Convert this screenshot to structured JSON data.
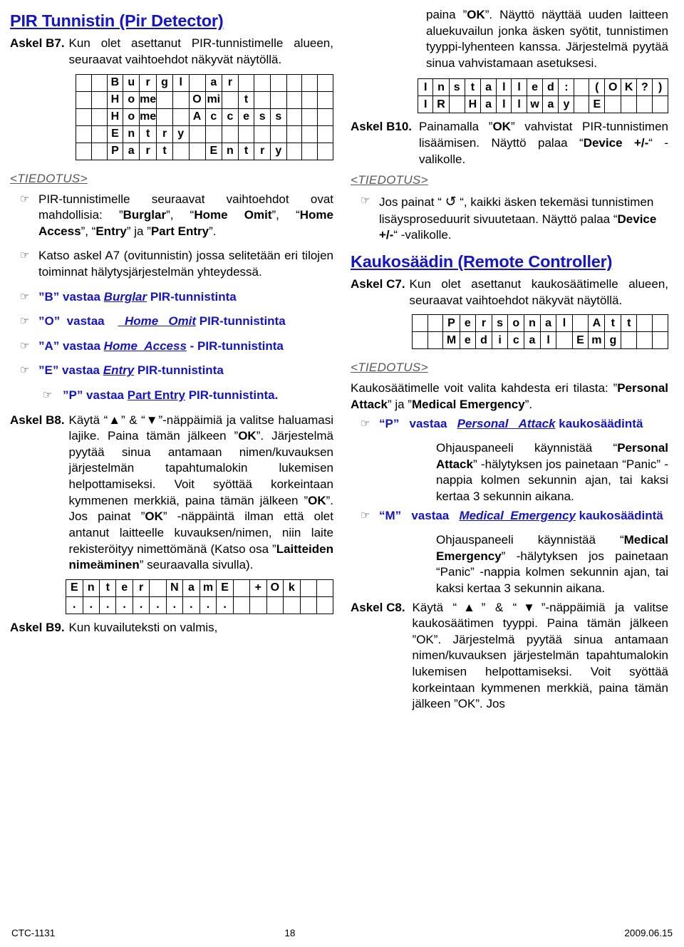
{
  "document": {
    "footer": {
      "left": "CTC-1131",
      "page": "18",
      "date": "2009.06.15"
    },
    "colors": {
      "heading_blue": "#1414c8",
      "note_gray": "#585858",
      "text": "#000000"
    }
  },
  "left_column": {
    "title": "PIR Tunnistin (Pir Detector)",
    "step_b7": {
      "label": "Askel B7.",
      "text": "Kun olet asettanut PIR-tunnistimelle alueen, seuraavat vaihtoehdot näkyvät näytöllä."
    },
    "lcd_b7": {
      "name": "pir-options-lcd",
      "columns": 16,
      "rows": [
        [
          "",
          "",
          "B",
          "u",
          "r",
          "g",
          "l",
          "",
          "a",
          "r",
          "",
          "",
          "",
          "",
          "",
          ""
        ],
        [
          "",
          "",
          "H",
          "o",
          "me",
          "",
          "",
          "O",
          "mi",
          "",
          "t",
          "",
          "",
          "",
          "",
          ""
        ],
        [
          "",
          "",
          "H",
          "o",
          "me",
          "",
          "",
          "A",
          "c",
          "c",
          "e",
          "s",
          "s",
          "",
          "",
          ""
        ],
        [
          "",
          "",
          "E",
          "n",
          "t",
          "r",
          "y",
          "",
          "",
          "",
          "",
          "",
          "",
          "",
          "",
          ""
        ],
        [
          "",
          "",
          "P",
          "a",
          "r",
          "t",
          "",
          "",
          "E",
          "n",
          "t",
          "r",
          "y",
          "",
          "",
          ""
        ]
      ]
    },
    "tiedotus_1": "<TIEDOTUS>",
    "note_1": {
      "icon": "pointing-hand-icon",
      "text": "PIR-tunnistimelle seuraavat vaihtoehdot ovat mahdollisia: ”Burglar”, “Home Omit”, “Home Access”, “Entry” ja ”Part Entry”.",
      "bold_terms": [
        "Burglar",
        "Home Omit",
        "Home Access",
        "Entry",
        "Part Entry"
      ]
    },
    "note_2": {
      "icon": "pointing-hand-icon",
      "text": "Katso askel A7 (ovitunnistin) jossa selitetään eri tilojen toiminnat hälytysjärjestelmän yhteydessä."
    },
    "mappings": [
      {
        "key": "”B”",
        "verb": "vastaa",
        "mode": "Burglar",
        "suffix": "PIR-tunnistinta"
      },
      {
        "key": "”O”",
        "verb": "vastaa",
        "mode": "Home Omit",
        "suffix": "PIR-tunnistinta"
      },
      {
        "key": "”A”",
        "verb": "vastaa",
        "mode": "Home Access",
        "suffix": "- PIR-tunnistinta"
      },
      {
        "key": "”E”",
        "verb": "vastaa",
        "mode": "Entry",
        "suffix": "PIR-tunnistinta"
      },
      {
        "key": "”P”",
        "verb": "vastaa",
        "mode": "Part Entry",
        "suffix": "PIR-tunnistinta."
      }
    ],
    "step_b8": {
      "label": "Askel B8.",
      "text_part1": "Käytä “",
      "up_arrow": "▲",
      "text_part2": "” & “",
      "down_arrow": "▼",
      "text_part3": "”-näppäimiä ja valitse haluamasi lajike. Paina tämän jälkeen ”OK”. Järjestelmä pyytää sinua antamaan nimen/kuvauksen järjestelmän tapahtumalokin lukemisen helpottamiseksi. Voit syöttää korkeintaan kymmenen merkkiä, paina tämän jälkeen ”OK”. Jos painat ”OK” -näppäintä ilman että olet antanut laitteelle kuvauksen/nimen, niin laite rekisteröityy nimettömänä (Katso osa ”Laitteiden nimeäminen” seuraavalla sivulla)."
    },
    "lcd_b8": {
      "name": "enter-name-lcd",
      "columns": 16,
      "rows": [
        [
          "E",
          "n",
          "t",
          "e",
          "r",
          "",
          "N",
          "a",
          "m",
          "E",
          "",
          "+",
          "O",
          "k",
          "",
          ""
        ],
        [
          ".",
          ".",
          ".",
          ".",
          ".",
          ".",
          ".",
          ".",
          ".",
          ".",
          "",
          "",
          "",
          "",
          "",
          ""
        ]
      ]
    },
    "step_b9": {
      "label": "Askel B9.",
      "text": "Kun kuvailuteksti on valmis,"
    }
  },
  "right_column": {
    "b9_continued": "paina ”OK”. Näyttö näyttää uuden laitteen aluekuvailun jonka äsken syötit, tunnistimen tyyppi-lyhenteen kanssa. Järjestelmä pyytää sinua vahvistamaan asetuksesi.",
    "lcd_installed": {
      "name": "installed-confirm-lcd",
      "columns": 16,
      "rows": [
        [
          "I",
          "n",
          "s",
          "t",
          "a",
          "l",
          "l",
          "e",
          "d",
          ":",
          "",
          "(",
          "O",
          "K",
          "?",
          ")"
        ],
        [
          "I",
          "R",
          "",
          "H",
          "a",
          "l",
          "l",
          "w",
          "a",
          "y",
          "",
          "E",
          "",
          "",
          "",
          ""
        ]
      ]
    },
    "step_b10": {
      "label": "Askel B10.",
      "text": "Painamalla ”OK” vahvistat PIR-tunnistimen lisäämisen. Näyttö palaa “Device +/-“ -valikolle."
    },
    "tiedotus_2": "<TIEDOTUS>",
    "note_3": {
      "icon": "pointing-hand-icon",
      "prefix": "Jos painat “",
      "symbol": "↺",
      "symbol_name": "return-arrow-icon",
      "suffix": "“, kaikki äsken tekemäsi tunnistimen lisäysproseduurit sivuutetaan. Näyttö palaa “Device +/-“ -valikolle."
    },
    "title": "Kaukosäädin (Remote Controller)",
    "step_c7": {
      "label": "Askel C7.",
      "text": "Kun olet asettanut kaukosäätimelle alueen, seuraavat vaihtoehdot näkyvät näytöllä."
    },
    "lcd_c7": {
      "name": "remote-options-lcd",
      "columns": 16,
      "rows": [
        [
          "",
          "",
          "P",
          "e",
          "r",
          "s",
          "o",
          "n",
          "a",
          "l",
          "",
          "A",
          "t",
          "t",
          "",
          ""
        ],
        [
          "",
          "",
          "M",
          "e",
          "d",
          "i",
          "c",
          "a",
          "l",
          "",
          "E",
          "m",
          "g",
          "",
          "",
          ""
        ]
      ]
    },
    "tiedotus_3": "<TIEDOTUS>",
    "remote_intro": "Kaukosäätimelle voit valita kahdesta eri tilasta: ”Personal Attack” ja ”Medical Emergency”.",
    "mapping_p": {
      "key": "“P”",
      "verb": "vastaa",
      "mode": "Personal Attack",
      "suffix": "kaukosäädintä"
    },
    "desc_p": "Ohjauspaneeli käynnistää “Personal Attack” -hälytyksen jos painetaan “Panic” -nappia kolmen sekunnin ajan, tai kaksi kertaa 3 sekunnin aikana.",
    "mapping_m": {
      "key": "“M”",
      "verb": "vastaa",
      "mode": "Medical Emergency",
      "suffix": "kaukosäädintä"
    },
    "desc_m": "Ohjauspaneeli käynnistää “Medical Emergency” -hälytyksen jos painetaan “Panic” -nappia kolmen sekunnin ajan, tai kaksi kertaa 3 sekunnin aikana.",
    "step_c8": {
      "label": "Askel C8.",
      "text_part1": "Käytä “",
      "up_arrow": "▲",
      "text_part2": "” & “",
      "down_arrow": "▼",
      "text_part3": "”-näppäimiä ja valitse kaukosäätimen tyyppi. Paina tämän jälkeen ”OK”. Järjestelmä pyytää sinua antamaan nimen/kuvauksen järjestelmän tapahtumalokin lukemisen helpottamiseksi. Voit syöttää korkeintaan kymmenen merkkiä, paina tämän jälkeen ”OK”. Jos"
    }
  }
}
